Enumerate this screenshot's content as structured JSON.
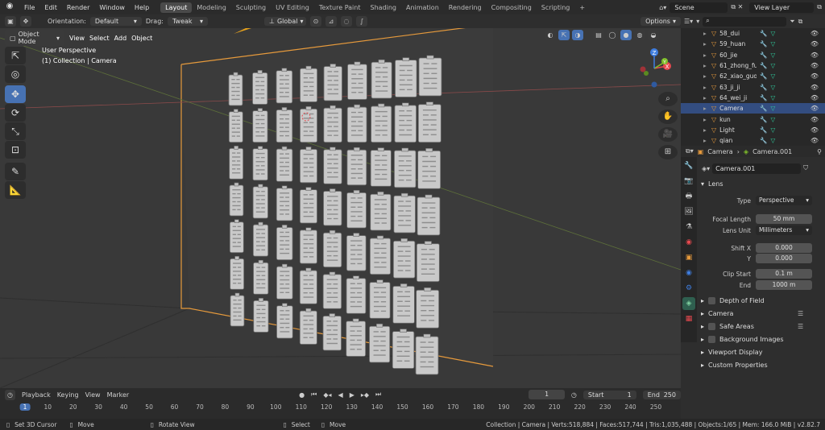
{
  "topbar": {
    "menus": [
      "File",
      "Edit",
      "Render",
      "Window",
      "Help"
    ],
    "workspaces": [
      "Layout",
      "Modeling",
      "Sculpting",
      "UV Editing",
      "Texture Paint",
      "Shading",
      "Animation",
      "Rendering",
      "Compositing",
      "Scripting"
    ],
    "active_workspace": "Layout",
    "add_tab": "+",
    "scene": "Scene",
    "view_layer": "View Layer"
  },
  "header": {
    "orientation_label": "Orientation:",
    "orientation_value": "Default",
    "drag_label": "Drag:",
    "drag_value": "Tweak",
    "transform_space": "Global",
    "options": "Options"
  },
  "viewport_header": {
    "mode": "Object Mode",
    "view": "View",
    "select": "Select",
    "add": "Add",
    "object": "Object"
  },
  "overlay": {
    "line1": "User Perspective",
    "line2": "(1) Collection | Camera"
  },
  "gizmo": {
    "x": "X",
    "y": "Y",
    "z": "Z"
  },
  "colors": {
    "accent": "#4772b3",
    "selection": "#334d80",
    "orange": "#e69a3c",
    "x_axis": "#e8494f",
    "y_axis": "#7fbf2a",
    "z_axis": "#3f7ee0",
    "camera_frame": "#e69a3c"
  },
  "outliner": {
    "search_placeholder": "",
    "items": [
      {
        "name": "58_dui",
        "selected": false
      },
      {
        "name": "59_huan",
        "selected": false
      },
      {
        "name": "60_jie",
        "selected": false
      },
      {
        "name": "61_zhong_fu",
        "selected": false
      },
      {
        "name": "62_xiao_guo",
        "selected": false
      },
      {
        "name": "63_ji_ji",
        "selected": false
      },
      {
        "name": "64_wei_ji",
        "selected": false
      },
      {
        "name": "Camera",
        "selected": true
      },
      {
        "name": "kun",
        "selected": false
      },
      {
        "name": "Light",
        "selected": false
      },
      {
        "name": "qian",
        "selected": false
      }
    ]
  },
  "properties": {
    "breadcrumb_object": "Camera",
    "breadcrumb_data": "Camera.001",
    "datablock": "Camera.001",
    "lens_section": "Lens",
    "type_label": "Type",
    "type_value": "Perspective",
    "focal_label": "Focal Length",
    "focal_value": "50 mm",
    "unit_label": "Lens Unit",
    "unit_value": "Millimeters",
    "shiftx_label": "Shift X",
    "shiftx_value": "0.000",
    "y_label": "Y",
    "y_value": "0.000",
    "clipstart_label": "Clip Start",
    "clipstart_value": "0.1 m",
    "end_label": "End",
    "end_value": "1000 m",
    "sections": [
      "Depth of Field",
      "Camera",
      "Safe Areas",
      "Background Images",
      "Viewport Display",
      "Custom Properties"
    ]
  },
  "timeline": {
    "playback": "Playback",
    "keying": "Keying",
    "view": "View",
    "marker": "Marker",
    "current_frame": "1",
    "start_label": "Start",
    "start_value": "1",
    "end_label": "End",
    "end_value": "250",
    "ticks": [
      "1",
      "10",
      "20",
      "30",
      "40",
      "50",
      "60",
      "70",
      "80",
      "90",
      "100",
      "110",
      "120",
      "130",
      "140",
      "150",
      "160",
      "170",
      "180",
      "190",
      "200",
      "210",
      "220",
      "230",
      "240",
      "250"
    ]
  },
  "status": {
    "left1": "Set 3D Cursor",
    "left2": "Move",
    "mid1": "Rotate View",
    "mid2": "Select",
    "mid3": "Move",
    "stats": "Collection | Camera | Verts:518,884 | Faces:517,744 | Tris:1,035,488 | Objects:1/65 | Mem: 166.0 MiB | v2.82.7"
  },
  "grid": {
    "columns": 9,
    "rows": 7
  }
}
